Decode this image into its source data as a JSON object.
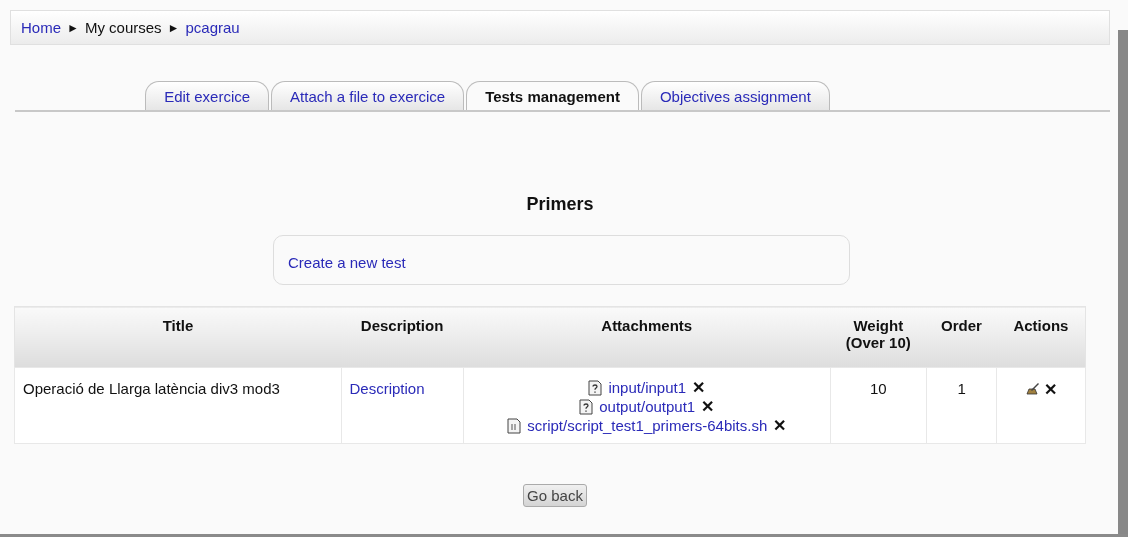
{
  "breadcrumb": [
    {
      "label": "Home",
      "link": true
    },
    {
      "label": "My courses",
      "link": false
    },
    {
      "label": "pcagrau",
      "link": true
    }
  ],
  "separator": "►",
  "tabs": [
    {
      "label": "Edit exercice",
      "selected": false
    },
    {
      "label": "Attach a file to exercice",
      "selected": false
    },
    {
      "label": "Tests management",
      "selected": true
    },
    {
      "label": "Objectives assignment",
      "selected": false
    }
  ],
  "heading": "Primers",
  "create_link": "Create a new test",
  "table": {
    "columns": [
      "Title",
      "Description",
      "Attachments",
      "Weight (Over 10)",
      "Order",
      "Actions"
    ],
    "rows": [
      {
        "title": "Operació de Llarga latència div3 mod3",
        "description": "Description",
        "attachments": [
          {
            "kind": "unknown",
            "name": "input/input1",
            "remove": "✕"
          },
          {
            "kind": "unknown",
            "name": "output/output1",
            "remove": "✕"
          },
          {
            "kind": "script",
            "name": "script/script_test1_primers-64bits.sh",
            "remove": "✕"
          }
        ],
        "weight": "10",
        "order": "1",
        "delete": "✕"
      }
    ]
  },
  "back_button": "Go back"
}
